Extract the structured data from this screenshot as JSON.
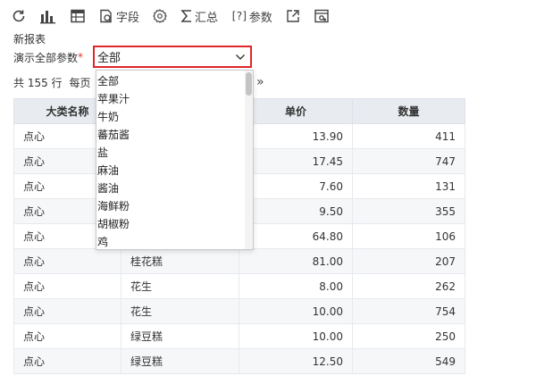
{
  "toolbar": {
    "field_label": "字段",
    "summary_label": "汇总",
    "param_bracket": "[?]",
    "param_label": "参数"
  },
  "report": {
    "title": "新报表"
  },
  "param": {
    "label": "演示全部参数",
    "required_mark": "*",
    "selected": "全部",
    "options": [
      "全部",
      "苹果汁",
      "牛奶",
      "蕃茄酱",
      "盐",
      "麻油",
      "酱油",
      "海鲜粉",
      "胡椒粉",
      "鸡"
    ]
  },
  "pager": {
    "total_text": "共 155 行",
    "per_page_text": "每页",
    "next_symbol": "»"
  },
  "table": {
    "headers": [
      "大类名称",
      "",
      "单价",
      "数量"
    ],
    "rows": [
      [
        "点心",
        "",
        "13.90",
        "411"
      ],
      [
        "点心",
        "",
        "17.45",
        "747"
      ],
      [
        "点心",
        "",
        "7.60",
        "131"
      ],
      [
        "点心",
        "",
        "9.50",
        "355"
      ],
      [
        "点心",
        "",
        "64.80",
        "106"
      ],
      [
        "点心",
        "桂花糕",
        "81.00",
        "207"
      ],
      [
        "点心",
        "花生",
        "8.00",
        "262"
      ],
      [
        "点心",
        "花生",
        "10.00",
        "754"
      ],
      [
        "点心",
        "绿豆糕",
        "10.00",
        "250"
      ],
      [
        "点心",
        "绿豆糕",
        "12.50",
        "549"
      ]
    ]
  },
  "colors": {
    "accent_red": "#e0262a",
    "header_bg": "#e8ecf1",
    "stripe_bg": "#f6f7f9"
  }
}
